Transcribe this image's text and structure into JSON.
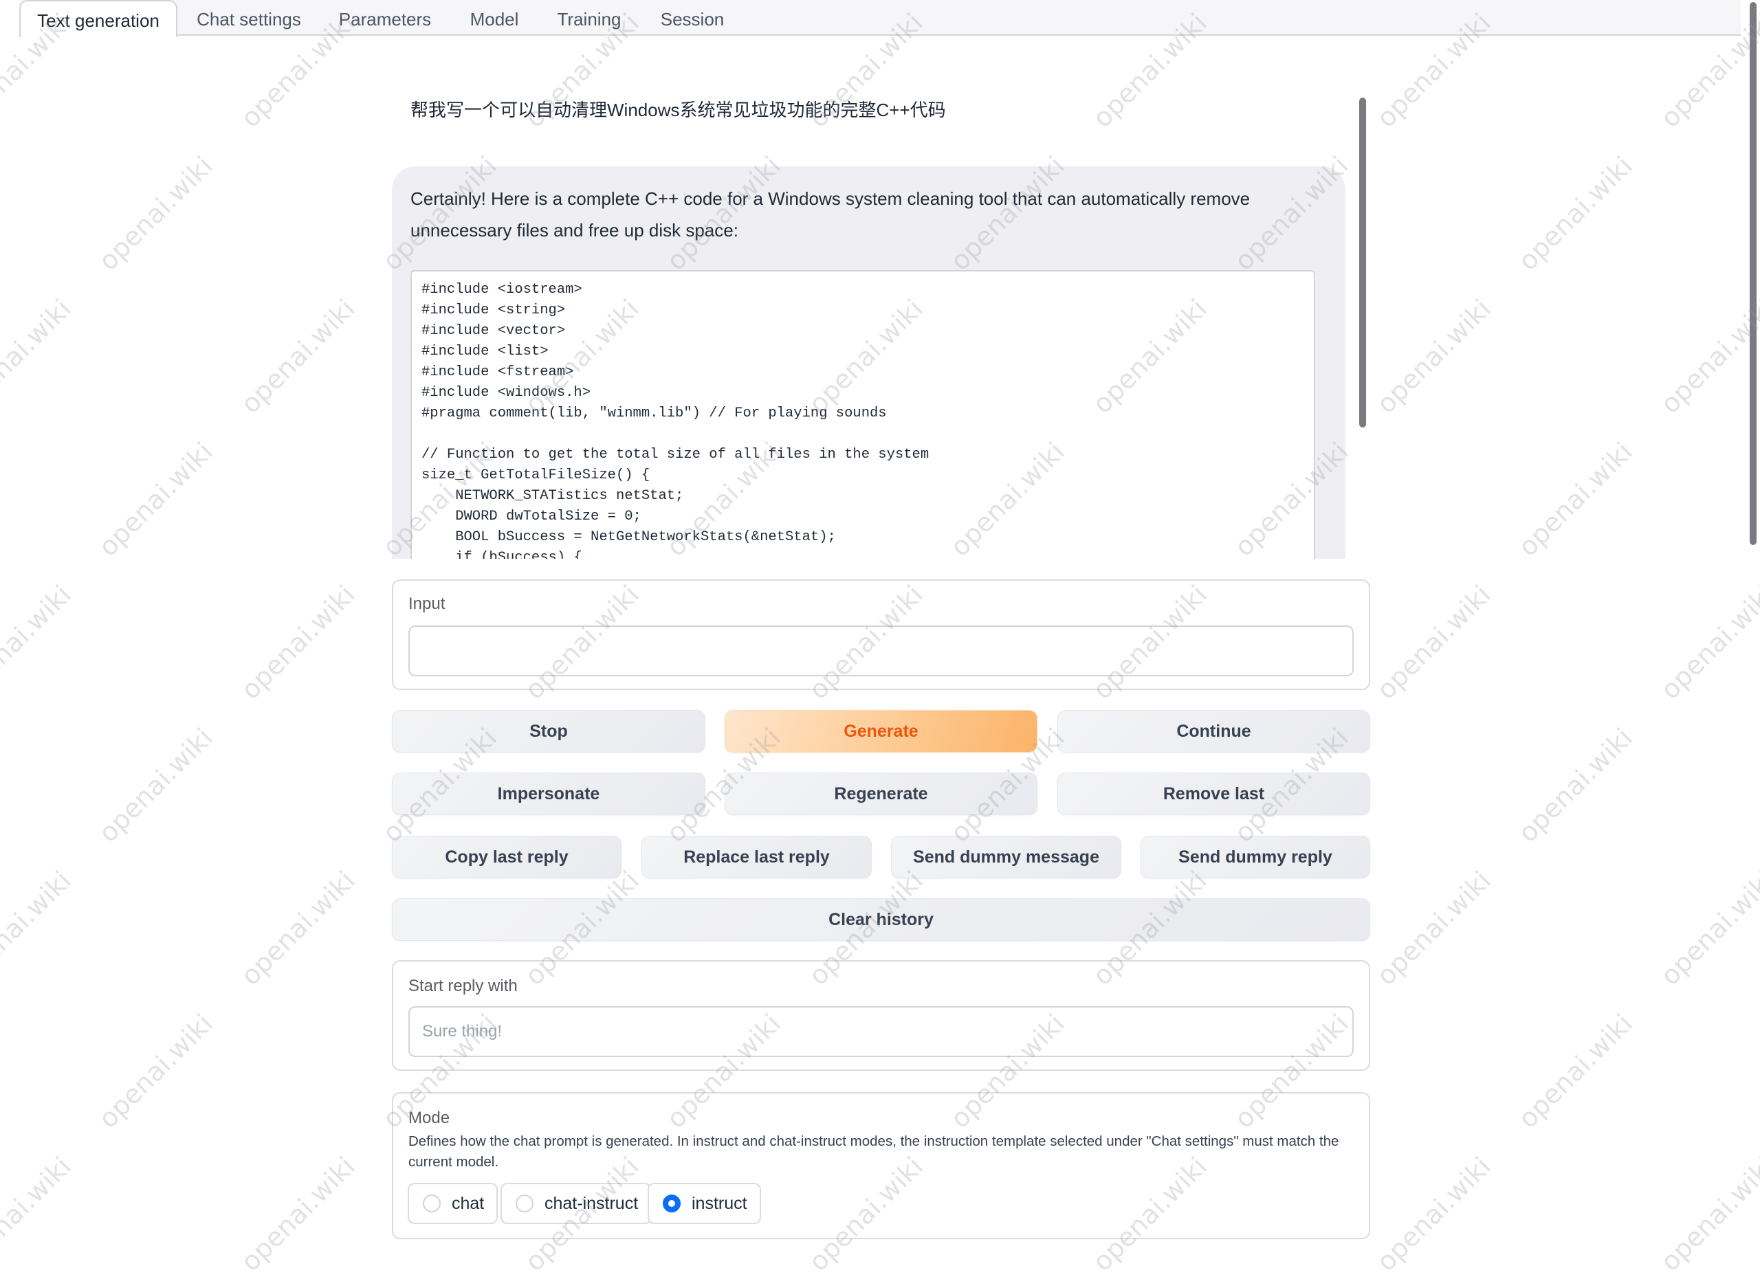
{
  "tabs": [
    {
      "label": "Text generation",
      "active": true
    },
    {
      "label": "Chat settings",
      "active": false
    },
    {
      "label": "Parameters",
      "active": false
    },
    {
      "label": "Model",
      "active": false
    },
    {
      "label": "Training",
      "active": false
    },
    {
      "label": "Session",
      "active": false
    }
  ],
  "chat": {
    "user_message": "帮我写一个可以自动清理Windows系统常见垃圾功能的完整C++代码",
    "bot_message": "Certainly! Here is a complete C++ code for a Windows system cleaning tool that can automatically remove unnecessary files and free up disk space:",
    "code_lines": [
      "#include <iostream>",
      "#include <string>",
      "#include <vector>",
      "#include <list>",
      "#include <fstream>",
      "#include <windows.h>",
      "#pragma comment(lib, \"winmm.lib\") // For playing sounds",
      "",
      "// Function to get the total size of all files in the system",
      "size_t GetTotalFileSize() {",
      "    NETWORK_STATistics netStat;",
      "    DWORD dwTotalSize = 0;",
      "    BOOL bSuccess = NetGetNetworkStats(&netStat);",
      "    if (bSuccess) {"
    ]
  },
  "input": {
    "label": "Input",
    "value": "",
    "placeholder": ""
  },
  "buttons": {
    "stop": "Stop",
    "generate": "Generate",
    "continue": "Continue",
    "impersonate": "Impersonate",
    "regenerate": "Regenerate",
    "remove_last": "Remove last",
    "copy_last_reply": "Copy last reply",
    "replace_last_reply": "Replace last reply",
    "send_dummy_message": "Send dummy message",
    "send_dummy_reply": "Send dummy reply",
    "clear_history": "Clear history"
  },
  "start_reply": {
    "label": "Start reply with",
    "value": "",
    "placeholder": "Sure thing!"
  },
  "mode": {
    "label": "Mode",
    "description": "Defines how the chat prompt is generated. In instruct and chat-instruct modes, the instruction template selected under \"Chat settings\" must match the current model.",
    "options": [
      "chat",
      "chat-instruct",
      "instruct"
    ],
    "selected": "instruct"
  },
  "colors": {
    "accent_orange": "#ea580c",
    "radio_selected": "#0b6ef5"
  },
  "watermark": "openai.wiki"
}
